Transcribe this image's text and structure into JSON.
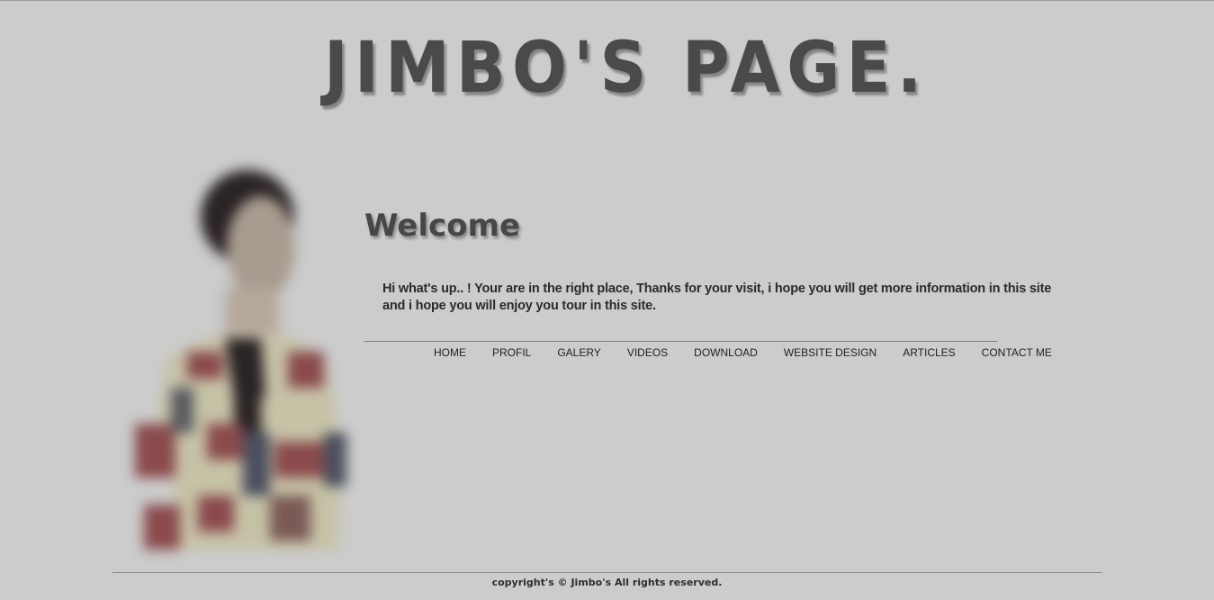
{
  "header": {
    "title": "JIMBO'S PAGE."
  },
  "main": {
    "heading": "Welcome",
    "intro": "Hi what's up.. ! Your are in the right place, Thanks for your visit, i hope you will get more information in this site and i hope you will enjoy you tour in this site."
  },
  "nav": {
    "items": [
      "HOME",
      "PROFIL",
      "GALERY",
      "VIDEOS",
      "DOWNLOAD",
      "WEBSITE DESIGN",
      "ARTICLES",
      "CONTACT ME"
    ]
  },
  "footer": {
    "copyright": "copyright's © Jimbo's All rights reserved."
  },
  "colors": {
    "background": "#cccccc",
    "title": "#4a4a4a",
    "text": "#2b2b2b"
  }
}
